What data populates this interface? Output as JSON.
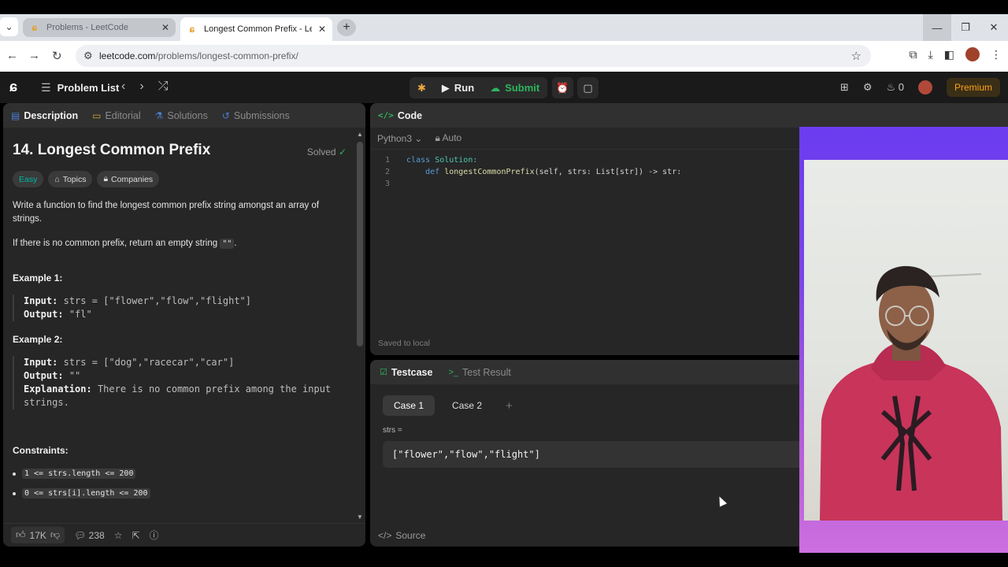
{
  "browser": {
    "tabs": [
      {
        "title": "Problems - LeetCode",
        "active": false
      },
      {
        "title": "Longest Common Prefix - LeetC",
        "active": true
      }
    ],
    "url_host": "leetcode.com",
    "url_path": "/problems/longest-common-prefix/"
  },
  "lc_top": {
    "problem_list": "Problem List",
    "run": "Run",
    "submit": "Submit",
    "streak": "0",
    "premium": "Premium"
  },
  "left_panel": {
    "tabs": [
      "Description",
      "Editorial",
      "Solutions",
      "Submissions"
    ],
    "title": "14. Longest Common Prefix",
    "solved": "Solved",
    "tags": [
      "Easy",
      "Topics",
      "Companies"
    ],
    "desc1": "Write a function to find the longest common prefix string amongst an array of strings.",
    "desc2_pre": "If there is no common prefix, return an empty string",
    "desc2_code": "\"\"",
    "desc2_post": ".",
    "example1": {
      "head": "Example 1:",
      "input_label": "Input:",
      "input": "strs = [\"flower\",\"flow\",\"flight\"]",
      "output_label": "Output:",
      "output": "\"fl\""
    },
    "example2": {
      "head": "Example 2:",
      "input_label": "Input:",
      "input": "strs = [\"dog\",\"racecar\",\"car\"]",
      "output_label": "Output:",
      "output": "\"\"",
      "expl_label": "Explanation:",
      "expl": "There is no common prefix among the input strings."
    },
    "constraints_head": "Constraints:",
    "constraints": [
      "1 <= strs.length <= 200",
      "0 <= strs[i].length <= 200"
    ],
    "footer": {
      "likes": "17K",
      "comments": "238"
    }
  },
  "code_panel": {
    "title": "Code",
    "language": "Python3",
    "mode": "Auto",
    "lines": [
      {
        "n": "1",
        "kw": "class",
        "name": "Solution",
        "rest": ":"
      },
      {
        "n": "2",
        "kw": "def",
        "name": "longestCommonPrefix",
        "rest": "(self, strs: List[str]) -> str:"
      },
      {
        "n": "3",
        "kw": "",
        "name": "",
        "rest": ""
      }
    ],
    "saved": "Saved to local"
  },
  "test_panel": {
    "tabs": [
      "Testcase",
      "Test Result"
    ],
    "cases": [
      "Case 1",
      "Case 2"
    ],
    "var_label": "strs =",
    "var_value": "[\"flower\",\"flow\",\"flight\"]",
    "source": "Source"
  }
}
